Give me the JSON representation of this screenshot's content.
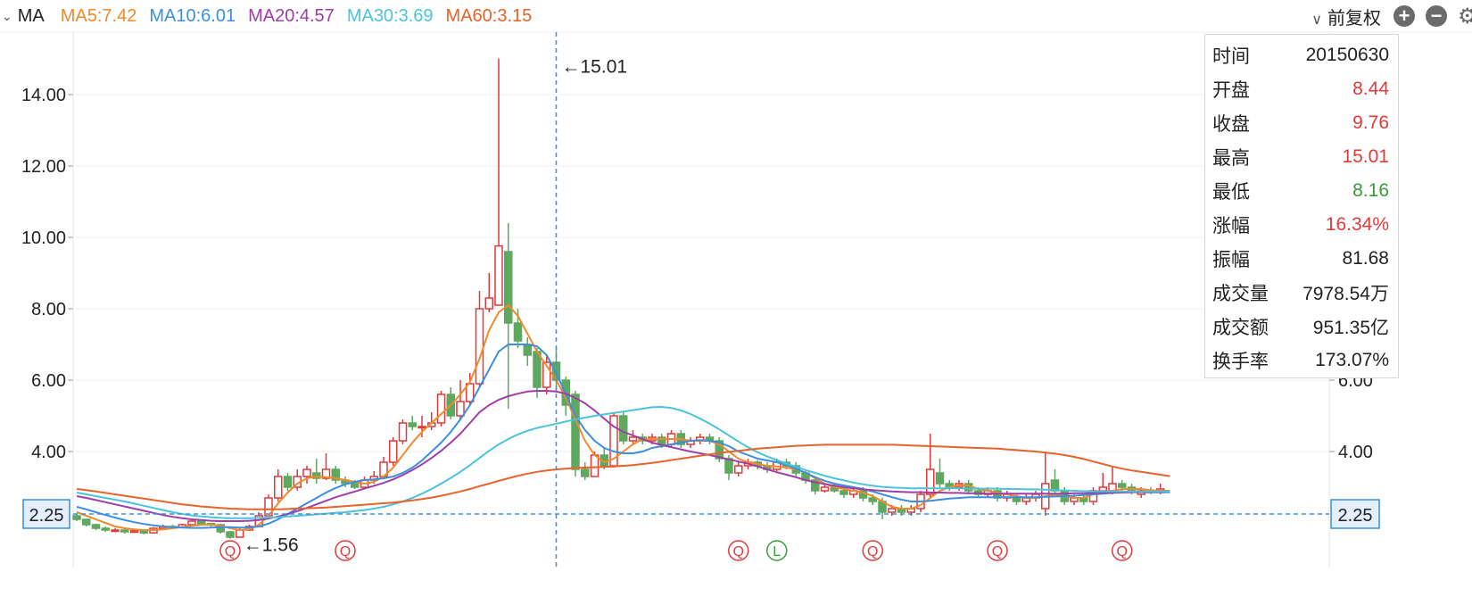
{
  "legend": {
    "indicator": "MA",
    "ma": [
      {
        "label": "MA5:7.42",
        "color": "#f08a2c"
      },
      {
        "label": "MA10:6.01",
        "color": "#3a8fe0"
      },
      {
        "label": "MA20:4.57",
        "color": "#a03ea8"
      },
      {
        "label": "MA30:3.69",
        "color": "#4ac3dc"
      },
      {
        "label": "MA60:3.15",
        "color": "#e8622a"
      }
    ]
  },
  "toolbar": {
    "adjust_label": "前复权",
    "zoom_in": "+",
    "zoom_out": "−"
  },
  "tooltip": {
    "rows": [
      {
        "k": "时间",
        "v": "20150630",
        "tone": ""
      },
      {
        "k": "开盘",
        "v": "8.44",
        "tone": "up"
      },
      {
        "k": "收盘",
        "v": "9.76",
        "tone": "up"
      },
      {
        "k": "最高",
        "v": "15.01",
        "tone": "up"
      },
      {
        "k": "最低",
        "v": "8.16",
        "tone": "down"
      },
      {
        "k": "涨幅",
        "v": "16.34%",
        "tone": "up"
      },
      {
        "k": "振幅",
        "v": "81.68",
        "tone": ""
      },
      {
        "k": "成交量",
        "v": "7978.54万",
        "tone": ""
      },
      {
        "k": "成交额",
        "v": "951.35亿",
        "tone": ""
      },
      {
        "k": "换手率",
        "v": "173.07%",
        "tone": ""
      }
    ]
  },
  "chart_data": {
    "type": "candlestick",
    "ylim": [
      0.8,
      15.8
    ],
    "yticks": [
      "14.00",
      "12.00",
      "10.00",
      "8.00",
      "6.00",
      "4.00"
    ],
    "ytick_values": [
      14,
      12,
      10,
      8,
      6,
      4
    ],
    "crosshair": {
      "price": 2.25,
      "label": "2.25",
      "index": 50
    },
    "annotations": {
      "max_label": "←15.01",
      "max_index": 50,
      "max_value": 15.01,
      "min_label": "←1.56",
      "min_index": 17,
      "min_value": 1.56
    },
    "colors": {
      "up": "#e03a3a",
      "down": "#5fa85f"
    },
    "candles": [
      [
        2.2,
        2.1,
        2.25,
        2.05
      ],
      [
        2.1,
        1.95,
        2.12,
        1.9
      ],
      [
        1.95,
        1.85,
        1.98,
        1.8
      ],
      [
        1.85,
        1.8,
        1.9,
        1.75
      ],
      [
        1.78,
        1.8,
        1.85,
        1.74
      ],
      [
        1.8,
        1.75,
        1.84,
        1.7
      ],
      [
        1.74,
        1.78,
        1.82,
        1.72
      ],
      [
        1.78,
        1.72,
        1.8,
        1.68
      ],
      [
        1.72,
        1.85,
        1.88,
        1.7
      ],
      [
        1.85,
        1.9,
        1.95,
        1.82
      ],
      [
        1.9,
        1.88,
        1.95,
        1.85
      ],
      [
        1.88,
        1.95,
        1.98,
        1.85
      ],
      [
        1.95,
        2.05,
        2.08,
        1.92
      ],
      [
        2.05,
        1.98,
        2.1,
        1.95
      ],
      [
        1.98,
        1.95,
        2.0,
        1.9
      ],
      [
        1.95,
        1.75,
        1.98,
        1.7
      ],
      [
        1.75,
        1.6,
        1.78,
        1.56
      ],
      [
        1.6,
        1.8,
        1.85,
        1.58
      ],
      [
        1.8,
        1.9,
        1.95,
        1.78
      ],
      [
        1.9,
        2.2,
        2.3,
        1.88
      ],
      [
        2.2,
        2.7,
        2.8,
        2.15
      ],
      [
        2.7,
        3.3,
        3.5,
        2.6
      ],
      [
        3.3,
        3.0,
        3.4,
        2.9
      ],
      [
        3.0,
        3.3,
        3.5,
        2.9
      ],
      [
        3.3,
        3.5,
        3.6,
        3.1
      ],
      [
        3.4,
        3.25,
        3.8,
        3.1
      ],
      [
        3.25,
        3.5,
        3.95,
        3.2
      ],
      [
        3.5,
        3.2,
        3.6,
        3.1
      ],
      [
        3.2,
        3.1,
        3.3,
        3.0
      ],
      [
        3.1,
        3.0,
        3.2,
        2.95
      ],
      [
        3.0,
        3.2,
        3.3,
        2.95
      ],
      [
        3.2,
        3.3,
        3.45,
        3.1
      ],
      [
        3.3,
        3.7,
        3.85,
        3.25
      ],
      [
        3.7,
        4.3,
        4.4,
        3.6
      ],
      [
        4.3,
        4.8,
        4.9,
        4.2
      ],
      [
        4.8,
        4.7,
        5.0,
        4.6
      ],
      [
        4.7,
        4.7,
        5.0,
        4.4
      ],
      [
        4.7,
        4.8,
        5.1,
        4.6
      ],
      [
        4.8,
        5.6,
        5.7,
        4.7
      ],
      [
        5.6,
        5.0,
        5.8,
        4.9
      ],
      [
        5.0,
        5.4,
        6.0,
        4.9
      ],
      [
        5.4,
        5.9,
        6.2,
        5.3
      ],
      [
        5.9,
        8.0,
        8.5,
        5.8
      ],
      [
        8.0,
        8.3,
        9.0,
        7.9
      ],
      [
        8.1,
        9.76,
        15.01,
        8.16
      ],
      [
        9.6,
        7.6,
        10.4,
        5.2
      ],
      [
        7.6,
        7.1,
        8.0,
        6.9
      ],
      [
        7.0,
        6.7,
        7.2,
        6.4
      ],
      [
        6.8,
        5.8,
        6.9,
        5.5
      ],
      [
        5.8,
        6.5,
        6.7,
        5.6
      ],
      [
        6.5,
        6.0,
        6.9,
        5.7
      ],
      [
        6.0,
        5.3,
        6.1,
        5.0
      ],
      [
        5.6,
        3.5,
        5.7,
        3.3
      ],
      [
        3.5,
        3.3,
        3.7,
        3.2
      ],
      [
        3.3,
        3.9,
        4.0,
        3.3
      ],
      [
        3.9,
        3.6,
        4.1,
        3.5
      ],
      [
        3.6,
        5.0,
        5.1,
        3.55
      ],
      [
        5.0,
        4.3,
        5.1,
        4.2
      ],
      [
        4.3,
        4.4,
        4.6,
        4.2
      ],
      [
        4.4,
        4.3,
        4.5,
        4.2
      ],
      [
        4.3,
        4.4,
        4.5,
        4.2
      ],
      [
        4.4,
        4.2,
        4.5,
        4.1
      ],
      [
        4.2,
        4.5,
        4.6,
        4.1
      ],
      [
        4.5,
        4.2,
        4.6,
        4.1
      ],
      [
        4.2,
        4.3,
        4.4,
        4.1
      ],
      [
        4.3,
        4.4,
        4.5,
        4.2
      ],
      [
        4.4,
        4.3,
        4.5,
        4.2
      ],
      [
        4.3,
        3.8,
        4.4,
        3.7
      ],
      [
        3.8,
        3.4,
        3.9,
        3.2
      ],
      [
        3.4,
        3.6,
        3.7,
        3.3
      ],
      [
        3.6,
        3.7,
        3.8,
        3.5
      ],
      [
        3.7,
        3.6,
        3.75,
        3.5
      ],
      [
        3.6,
        3.5,
        3.7,
        3.4
      ],
      [
        3.5,
        3.7,
        3.8,
        3.45
      ],
      [
        3.7,
        3.6,
        3.8,
        3.5
      ],
      [
        3.6,
        3.4,
        3.7,
        3.3
      ],
      [
        3.4,
        3.2,
        3.5,
        3.1
      ],
      [
        3.2,
        2.9,
        3.3,
        2.8
      ],
      [
        2.9,
        3.0,
        3.1,
        2.85
      ],
      [
        3.0,
        2.9,
        3.1,
        2.85
      ],
      [
        2.9,
        2.8,
        3.0,
        2.7
      ],
      [
        2.8,
        2.9,
        3.0,
        2.7
      ],
      [
        2.9,
        2.7,
        3.0,
        2.6
      ],
      [
        2.7,
        2.6,
        2.8,
        2.5
      ],
      [
        2.6,
        2.3,
        2.7,
        2.1
      ],
      [
        2.3,
        2.4,
        2.5,
        2.2
      ],
      [
        2.4,
        2.3,
        2.5,
        2.2
      ],
      [
        2.3,
        2.4,
        2.5,
        2.2
      ],
      [
        2.4,
        2.8,
        2.9,
        2.3
      ],
      [
        2.8,
        3.5,
        4.5,
        2.7
      ],
      [
        3.4,
        3.1,
        3.8,
        3.0
      ],
      [
        3.1,
        3.0,
        3.2,
        2.9
      ],
      [
        3.0,
        3.1,
        3.2,
        2.9
      ],
      [
        3.1,
        2.9,
        3.2,
        2.8
      ],
      [
        2.9,
        2.8,
        3.0,
        2.7
      ],
      [
        2.8,
        2.9,
        3.0,
        2.7
      ],
      [
        2.9,
        2.7,
        3.0,
        2.6
      ],
      [
        2.7,
        2.8,
        2.9,
        2.6
      ],
      [
        2.7,
        2.6,
        2.8,
        2.5
      ],
      [
        2.6,
        2.7,
        2.8,
        2.5
      ],
      [
        2.7,
        2.8,
        2.9,
        2.6
      ],
      [
        2.4,
        3.1,
        4.0,
        2.2
      ],
      [
        3.2,
        2.9,
        3.5,
        2.8
      ],
      [
        2.9,
        2.6,
        3.0,
        2.5
      ],
      [
        2.6,
        2.7,
        2.8,
        2.5
      ],
      [
        2.7,
        2.6,
        2.8,
        2.5
      ],
      [
        2.6,
        2.9,
        3.0,
        2.5
      ],
      [
        2.9,
        3.0,
        3.4,
        2.8
      ],
      [
        2.9,
        3.1,
        3.6,
        2.8
      ],
      [
        3.1,
        3.0,
        3.2,
        2.9
      ],
      [
        3.0,
        2.9,
        3.1,
        2.8
      ],
      [
        2.8,
        2.9,
        3.0,
        2.7
      ],
      [
        2.9,
        2.85,
        3.0,
        2.8
      ],
      [
        2.85,
        2.95,
        3.1,
        2.8
      ]
    ],
    "ma": {
      "MA5": [
        2.3,
        2.2,
        2.1,
        2.0,
        1.9,
        1.85,
        1.82,
        1.8,
        1.8,
        1.82,
        1.85,
        1.88,
        1.92,
        1.95,
        1.95,
        1.92,
        1.85,
        1.8,
        1.82,
        1.95,
        2.2,
        2.55,
        2.85,
        3.1,
        3.25,
        3.3,
        3.28,
        3.25,
        3.2,
        3.15,
        3.1,
        3.15,
        3.3,
        3.55,
        3.9,
        4.25,
        4.55,
        4.8,
        5.05,
        5.3,
        5.6,
        5.95,
        6.6,
        7.4,
        7.9,
        8.1,
        7.8,
        7.3,
        6.8,
        6.4,
        6.0,
        5.5,
        4.9,
        4.3,
        3.9,
        3.7,
        3.8,
        4.0,
        4.2,
        4.35,
        4.35,
        4.35,
        4.35,
        4.35,
        4.3,
        4.3,
        4.3,
        4.2,
        4.0,
        3.8,
        3.7,
        3.65,
        3.6,
        3.58,
        3.55,
        3.5,
        3.4,
        3.25,
        3.1,
        3.0,
        2.95,
        2.9,
        2.85,
        2.75,
        2.6,
        2.45,
        2.4,
        2.4,
        2.5,
        2.7,
        2.9,
        3.0,
        3.05,
        3.05,
        2.95,
        2.9,
        2.85,
        2.8,
        2.75,
        2.7,
        2.7,
        2.75,
        2.8,
        2.75,
        2.7,
        2.7,
        2.8,
        2.85,
        2.9,
        2.95,
        2.95,
        2.95,
        2.92,
        2.9,
        2.9
      ],
      "MA10": [
        2.45,
        2.38,
        2.3,
        2.22,
        2.15,
        2.08,
        2.02,
        1.97,
        1.93,
        1.9,
        1.88,
        1.87,
        1.86,
        1.86,
        1.87,
        1.88,
        1.88,
        1.87,
        1.87,
        1.9,
        1.98,
        2.1,
        2.25,
        2.4,
        2.55,
        2.7,
        2.85,
        2.98,
        3.08,
        3.15,
        3.2,
        3.22,
        3.25,
        3.3,
        3.4,
        3.55,
        3.75,
        4.0,
        4.25,
        4.55,
        4.9,
        5.3,
        5.8,
        6.3,
        6.8,
        7.0,
        7.0,
        7.0,
        6.95,
        6.7,
        6.2,
        5.6,
        5.0,
        4.6,
        4.3,
        4.1,
        4.0,
        3.95,
        3.95,
        4.0,
        4.1,
        4.15,
        4.2,
        4.25,
        4.3,
        4.32,
        4.3,
        4.25,
        4.15,
        4.0,
        3.9,
        3.8,
        3.75,
        3.7,
        3.62,
        3.52,
        3.4,
        3.28,
        3.18,
        3.1,
        3.05,
        3.0,
        2.95,
        2.88,
        2.8,
        2.72,
        2.65,
        2.6,
        2.6,
        2.62,
        2.65,
        2.68,
        2.7,
        2.72,
        2.72,
        2.72,
        2.72,
        2.72,
        2.72,
        2.72,
        2.72,
        2.73,
        2.74,
        2.75,
        2.76,
        2.78,
        2.8,
        2.82,
        2.84,
        2.85,
        2.86,
        2.86,
        2.86,
        2.86,
        2.86
      ],
      "MA20": [
        2.75,
        2.7,
        2.64,
        2.58,
        2.52,
        2.46,
        2.4,
        2.34,
        2.28,
        2.22,
        2.17,
        2.13,
        2.1,
        2.08,
        2.06,
        2.05,
        2.05,
        2.05,
        2.06,
        2.08,
        2.12,
        2.18,
        2.25,
        2.33,
        2.42,
        2.52,
        2.62,
        2.72,
        2.8,
        2.88,
        2.96,
        3.04,
        3.12,
        3.22,
        3.34,
        3.48,
        3.64,
        3.82,
        4.02,
        4.25,
        4.5,
        4.8,
        5.1,
        5.3,
        5.45,
        5.55,
        5.62,
        5.68,
        5.7,
        5.7,
        5.68,
        5.62,
        5.5,
        5.35,
        5.15,
        4.92,
        4.7,
        4.55,
        4.45,
        4.35,
        4.25,
        4.18,
        4.12,
        4.06,
        4.0,
        3.95,
        3.9,
        3.84,
        3.78,
        3.72,
        3.66,
        3.58,
        3.5,
        3.42,
        3.35,
        3.28,
        3.2,
        3.14,
        3.09,
        3.04,
        3.0,
        2.97,
        2.94,
        2.92,
        2.9,
        2.88,
        2.87,
        2.86,
        2.86,
        2.85,
        2.85,
        2.84,
        2.84,
        2.83,
        2.83,
        2.82,
        2.82,
        2.82,
        2.82,
        2.82,
        2.82,
        2.82,
        2.82,
        2.82,
        2.83,
        2.83,
        2.84,
        2.84,
        2.85,
        2.86,
        2.86,
        2.87,
        2.87,
        2.88,
        2.88
      ],
      "MA30": [
        2.85,
        2.8,
        2.75,
        2.7,
        2.65,
        2.6,
        2.54,
        2.48,
        2.42,
        2.36,
        2.3,
        2.25,
        2.21,
        2.18,
        2.16,
        2.14,
        2.13,
        2.13,
        2.13,
        2.14,
        2.15,
        2.16,
        2.18,
        2.2,
        2.22,
        2.24,
        2.26,
        2.28,
        2.3,
        2.33,
        2.36,
        2.4,
        2.45,
        2.52,
        2.6,
        2.7,
        2.82,
        2.95,
        3.1,
        3.26,
        3.43,
        3.62,
        3.82,
        4.02,
        4.2,
        4.35,
        4.48,
        4.58,
        4.66,
        4.72,
        4.78,
        4.84,
        4.9,
        4.95,
        5.0,
        5.04,
        5.08,
        5.12,
        5.16,
        5.2,
        5.24,
        5.25,
        5.22,
        5.15,
        5.05,
        4.92,
        4.78,
        4.62,
        4.45,
        4.28,
        4.12,
        3.98,
        3.86,
        3.76,
        3.66,
        3.57,
        3.48,
        3.4,
        3.32,
        3.25,
        3.19,
        3.13,
        3.08,
        3.04,
        3.01,
        2.99,
        2.98,
        2.97,
        2.97,
        2.97,
        2.97,
        2.97,
        2.97,
        2.96,
        2.96,
        2.96,
        2.96,
        2.95,
        2.95,
        2.94,
        2.94,
        2.93,
        2.92,
        2.91,
        2.9,
        2.89,
        2.88,
        2.88,
        2.88,
        2.88,
        2.88,
        2.88,
        2.88,
        2.88,
        2.88
      ],
      "MA60": [
        2.95,
        2.92,
        2.88,
        2.84,
        2.8,
        2.76,
        2.72,
        2.68,
        2.64,
        2.6,
        2.56,
        2.52,
        2.49,
        2.46,
        2.44,
        2.42,
        2.4,
        2.39,
        2.38,
        2.38,
        2.38,
        2.38,
        2.39,
        2.4,
        2.41,
        2.42,
        2.43,
        2.45,
        2.47,
        2.49,
        2.51,
        2.53,
        2.55,
        2.57,
        2.6,
        2.63,
        2.67,
        2.71,
        2.76,
        2.82,
        2.88,
        2.95,
        3.03,
        3.1,
        3.18,
        3.25,
        3.32,
        3.38,
        3.43,
        3.47,
        3.5,
        3.52,
        3.54,
        3.55,
        3.56,
        3.57,
        3.58,
        3.6,
        3.62,
        3.65,
        3.68,
        3.72,
        3.76,
        3.8,
        3.84,
        3.88,
        3.92,
        3.96,
        3.99,
        4.02,
        4.05,
        4.08,
        4.1,
        4.12,
        4.14,
        4.16,
        4.17,
        4.18,
        4.19,
        4.19,
        4.19,
        4.19,
        4.19,
        4.19,
        4.19,
        4.19,
        4.18,
        4.17,
        4.16,
        4.15,
        4.14,
        4.13,
        4.12,
        4.11,
        4.1,
        4.09,
        4.08,
        4.06,
        4.04,
        4.02,
        4.0,
        3.97,
        3.94,
        3.9,
        3.85,
        3.79,
        3.72,
        3.65,
        3.58,
        3.52,
        3.47,
        3.43,
        3.39,
        3.35,
        3.31
      ]
    },
    "markers": [
      {
        "label": "Q",
        "index": 16,
        "color": "#e03a3a"
      },
      {
        "label": "Q",
        "index": 28,
        "color": "#e03a3a"
      },
      {
        "label": "Q",
        "index": 69,
        "color": "#e03a3a"
      },
      {
        "label": "L",
        "index": 73,
        "color": "#3a9a3a"
      },
      {
        "label": "Q",
        "index": 83,
        "color": "#e03a3a"
      },
      {
        "label": "Q",
        "index": 96,
        "color": "#e03a3a"
      },
      {
        "label": "Q",
        "index": 109,
        "color": "#e03a3a"
      }
    ]
  }
}
